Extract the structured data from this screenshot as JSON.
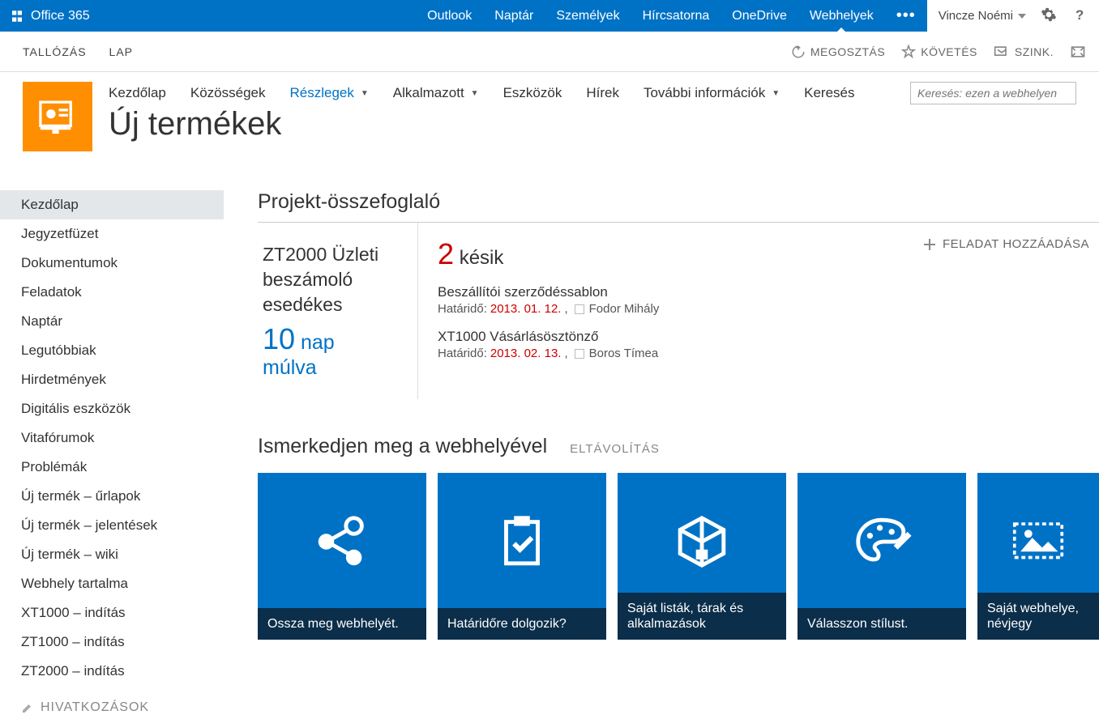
{
  "suite": {
    "brand": "Office 365",
    "apps": [
      "Outlook",
      "Naptár",
      "Személyek",
      "Hírcsatorna",
      "OneDrive",
      "Webhelyek"
    ],
    "activeApp": "Webhelyek",
    "more": "•••",
    "user": "Vincze Noémi"
  },
  "ribbon": {
    "tabs": [
      "TALLÓZÁS",
      "LAP"
    ],
    "actions": {
      "share": "MEGOSZTÁS",
      "follow": "KÖVETÉS",
      "sync": "SZINK."
    }
  },
  "topnav": {
    "items": [
      "Kezdőlap",
      "Közösségek",
      "Részlegek",
      "Alkalmazott",
      "Eszközök",
      "Hírek",
      "További információk",
      "Keresés"
    ],
    "current": "Részlegek",
    "searchPlaceholder": "Keresés: ezen a webhelyen"
  },
  "site": {
    "title": "Új termékek"
  },
  "quickLaunch": {
    "items": [
      "Kezdőlap",
      "Jegyzetfüzet",
      "Dokumentumok",
      "Feladatok",
      "Naptár",
      "Legutóbbiak",
      "Hirdetmények",
      "Digitális eszközök",
      "Vitafórumok",
      "Problémák",
      "Új termék – űrlapok",
      "Új termék – jelentések",
      "Új termék – wiki",
      "Webhely tartalma",
      "XT1000 – indítás",
      "ZT1000 – indítás",
      "ZT2000 – indítás"
    ],
    "selected": "Kezdőlap",
    "linksHeading": "HIVATKOZÁSOK"
  },
  "summary": {
    "heading": "Projekt-összefoglaló",
    "left_line1": "ZT2000 Üzleti beszámoló esedékes",
    "left_num": "10",
    "left_after": "nap múlva",
    "late_num": "2",
    "late_text": "késik",
    "deadlineLabel": "Határidő:",
    "addTask": "FELADAT HOZZÁADÁSA",
    "tasks": [
      {
        "name": "Beszállítói szerződéssablon",
        "date": "2013. 01. 12.",
        "user": "Fodor Mihály"
      },
      {
        "name": "XT1000 Vásárlásösztönző",
        "date": "2013. 02. 13.",
        "user": "Boros Tímea"
      }
    ]
  },
  "getstarted": {
    "heading": "Ismerkedjen meg a webhelyével",
    "remove": "ELTÁVOLÍTÁS",
    "tiles": [
      "Ossza meg webhelyét.",
      "Határidőre dolgozik?",
      "Saját listák, tárak és alkalmazások",
      "Válasszon stílust.",
      "Saját webhelye, névjegy"
    ]
  }
}
